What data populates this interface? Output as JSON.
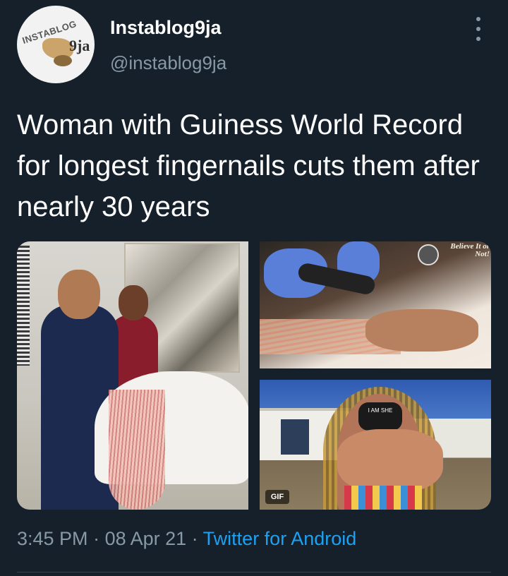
{
  "account": {
    "display_name": "Instablog9ja",
    "handle": "@instablog9ja",
    "avatar_logo_text": "INSTABLOG",
    "avatar_logo_suffix": "9ja"
  },
  "tweet": {
    "text": "Woman with Guiness World Record for longest fingernails cuts them after nearly 30 years",
    "media": {
      "gif_badge": "GIF",
      "image2_overlay": "Believe It or Not!",
      "image3_mask_text": "I AM SHE"
    }
  },
  "meta": {
    "time": "3:45 PM",
    "separator1": " · ",
    "date": "08 Apr 21",
    "separator2": " · ",
    "source": "Twitter for Android"
  },
  "icons": {
    "more": "more-vertical-icon"
  },
  "colors": {
    "background": "#15202b",
    "secondary_text": "#8899a6",
    "link": "#1da1f2"
  }
}
